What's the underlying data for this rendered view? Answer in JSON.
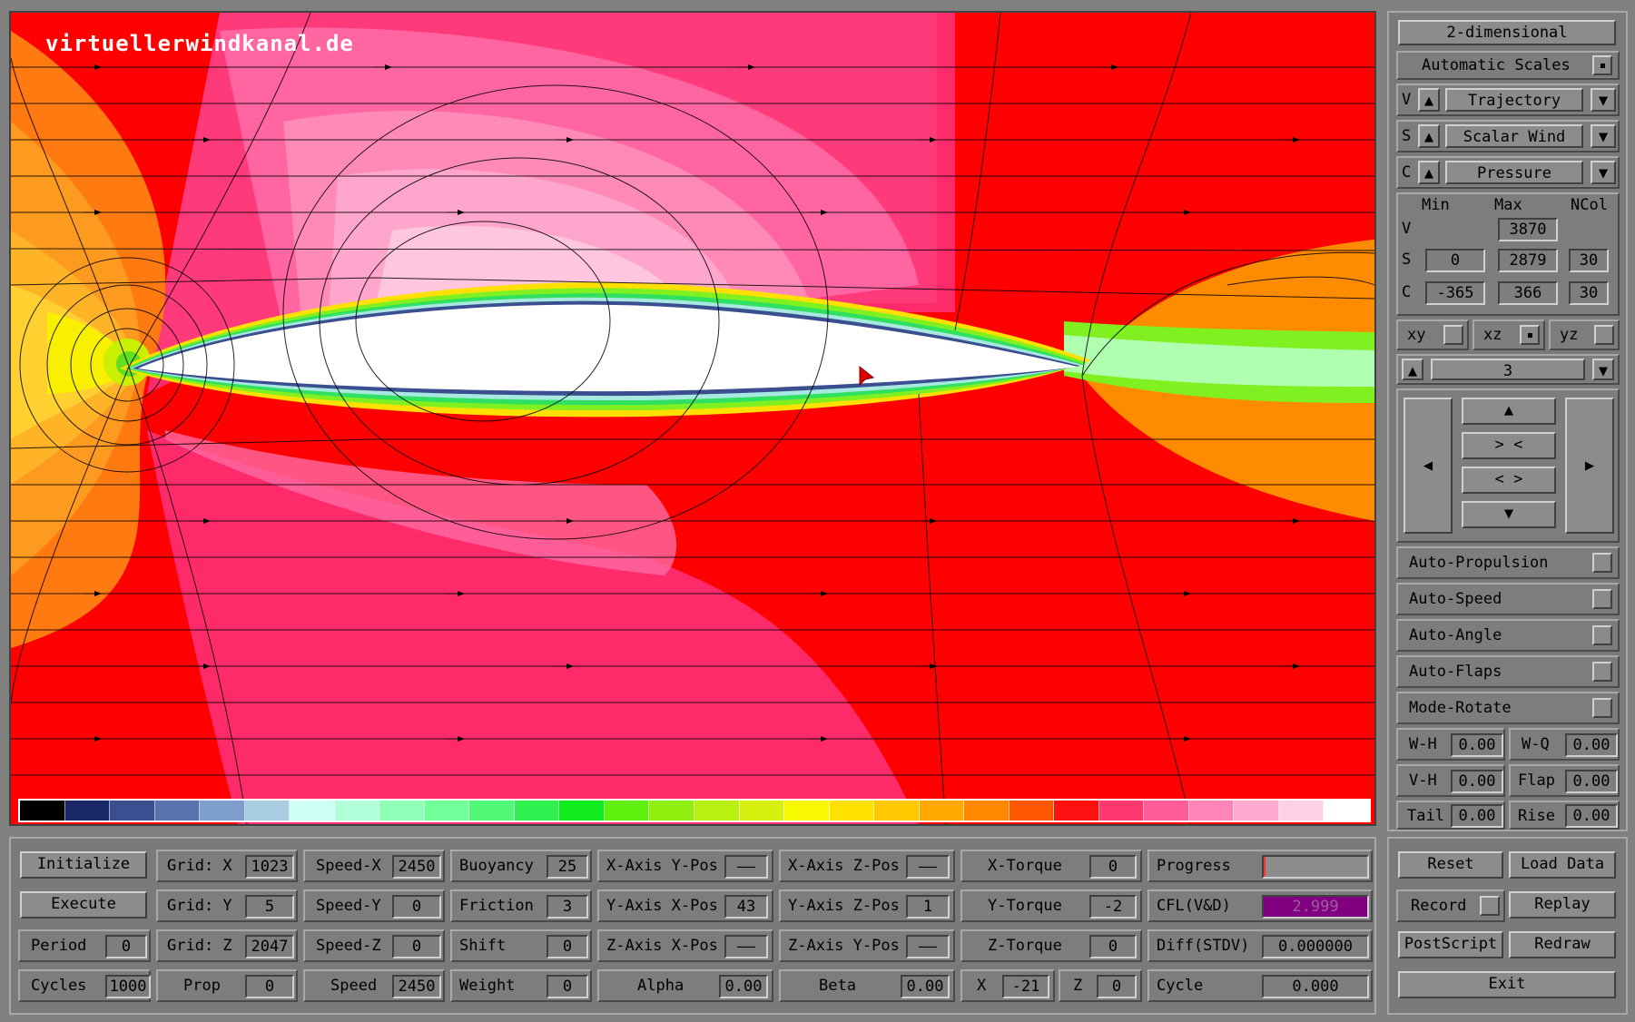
{
  "site_label": "virtuellerwindkanal.de",
  "right": {
    "mode": "2-dimensional",
    "auto_scales": "Automatic Scales",
    "v_label": "V",
    "s_label": "S",
    "c_label": "C",
    "v_select": "Trajectory",
    "s_select": "Scalar Wind",
    "c_select": "Pressure",
    "col_min": "Min",
    "col_max": "Max",
    "col_ncol": "NCol",
    "v_max": "3870",
    "s_min": "0",
    "s_max": "2879",
    "s_ncol": "30",
    "c_min": "-365",
    "c_max": "366",
    "c_ncol": "30",
    "plane_xy": "xy",
    "plane_xz": "xz",
    "plane_yz": "yz",
    "slice_value": "3",
    "nav_up": "▲",
    "nav_down": "▼",
    "nav_left": "◀",
    "nav_right": "▶",
    "nav_zoom_in": "> <",
    "nav_zoom_out": "< >",
    "auto_propulsion": "Auto-Propulsion",
    "auto_speed": "Auto-Speed",
    "auto_angle": "Auto-Angle",
    "auto_flaps": "Auto-Flaps",
    "mode_rotate": "Mode-Rotate",
    "wh_label": "W-H",
    "wh_val": "0.00",
    "wq_label": "W-Q",
    "wq_val": "0.00",
    "vh_label": "V-H",
    "vh_val": "0.00",
    "flap_label": "Flap",
    "flap_val": "0.00",
    "tail_label": "Tail",
    "tail_val": "0.00",
    "rise_label": "Rise",
    "rise_val": "0.00"
  },
  "bottom": {
    "initialize": "Initialize",
    "execute": "Execute",
    "period_label": "Period",
    "period_val": "0",
    "cycles_label": "Cycles",
    "cycles_val": "1000",
    "gridx_label": "Grid: X",
    "gridx_val": "1023",
    "gridy_label": "Grid: Y",
    "gridy_val": "5",
    "gridz_label": "Grid: Z",
    "gridz_val": "2047",
    "prop_label": "Prop",
    "prop_val": "0",
    "speedx_label": "Speed-X",
    "speedx_val": "2450",
    "speedy_label": "Speed-Y",
    "speedy_val": "0",
    "speedz_label": "Speed-Z",
    "speedz_val": "0",
    "speed_label": "Speed",
    "speed_val": "2450",
    "buoyancy_label": "Buoyancy",
    "buoyancy_val": "25",
    "friction_label": "Friction",
    "friction_val": "3",
    "shift_label": "Shift",
    "shift_val": "0",
    "weight_label": "Weight",
    "weight_val": "0",
    "xaxis_ypos_label": "X-Axis Y-Pos",
    "xaxis_ypos_val": "——",
    "yaxis_xpos_label": "Y-Axis X-Pos",
    "yaxis_xpos_val": "43",
    "zaxis_xpos_label": "Z-Axis X-Pos",
    "zaxis_xpos_val": "——",
    "alpha_label": "Alpha",
    "alpha_val": "0.00",
    "xaxis_zpos_label": "X-Axis Z-Pos",
    "xaxis_zpos_val": "——",
    "yaxis_zpos_label": "Y-Axis Z-Pos",
    "yaxis_zpos_val": "1",
    "zaxis_ypos_label": "Z-Axis Y-Pos",
    "zaxis_ypos_val": "——",
    "beta_label": "Beta",
    "beta_val": "0.00",
    "xtorque_label": "X-Torque",
    "xtorque_val": "0",
    "ytorque_label": "Y-Torque",
    "ytorque_val": "-2",
    "ztorque_label": "Z-Torque",
    "ztorque_val": "0",
    "x_label": "X",
    "x_val": "-21",
    "z_label": "Z",
    "z_val": "0",
    "progress_label": "Progress",
    "cfl_label": "CFL(V&D)",
    "cfl_val": "2.999",
    "diff_label": "Diff(STDV)",
    "diff_val": "0.000000",
    "cycle_label": "Cycle",
    "cycle_val": "0.000"
  },
  "actions": {
    "reset": "Reset",
    "load_data": "Load Data",
    "record": "Record",
    "replay": "Replay",
    "postscript": "PostScript",
    "redraw": "Redraw",
    "exit": "Exit"
  },
  "colorbar": [
    "#000000",
    "#1a2868",
    "#3a4e90",
    "#5872b0",
    "#7e9ecc",
    "#a8cce0",
    "#d0fff4",
    "#b0ffd8",
    "#90ffb8",
    "#70ff98",
    "#50f878",
    "#30f050",
    "#10ec20",
    "#60f010",
    "#90f010",
    "#b8f010",
    "#d8f010",
    "#f8f800",
    "#ffe000",
    "#ffc800",
    "#ffa800",
    "#ff8800",
    "#ff5800",
    "#ff1010",
    "#ff3870",
    "#ff5c98",
    "#ff84b8",
    "#ffaad0",
    "#ffd0e4",
    "#ffffff"
  ],
  "colors": {
    "progress_fill": "#ff3030",
    "cfl_fill": "#800080"
  }
}
